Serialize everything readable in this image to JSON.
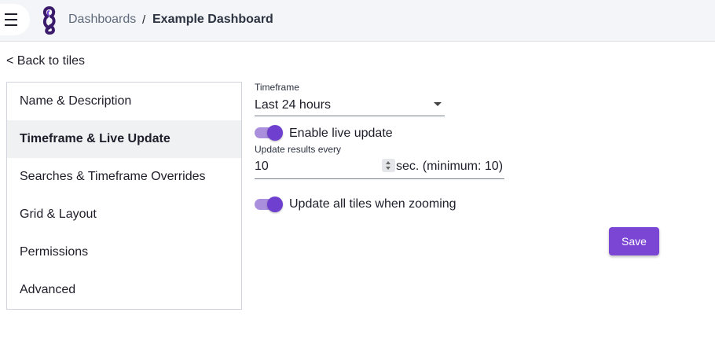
{
  "header": {
    "breadcrumb_parent": "Dashboards",
    "breadcrumb_separator": "/",
    "breadcrumb_current": "Example Dashboard"
  },
  "back_link": "< Back to tiles",
  "sidebar": {
    "items": [
      {
        "label": "Name & Description",
        "active": false
      },
      {
        "label": "Timeframe & Live Update",
        "active": true
      },
      {
        "label": "Searches & Timeframe Overrides",
        "active": false
      },
      {
        "label": "Grid & Layout",
        "active": false
      },
      {
        "label": "Permissions",
        "active": false
      },
      {
        "label": "Advanced",
        "active": false
      }
    ]
  },
  "form": {
    "timeframe_label": "Timeframe",
    "timeframe_value": "Last 24 hours",
    "live_update_label": "Enable live update",
    "live_update_enabled": true,
    "update_every_label": "Update results every",
    "update_every_value": "10",
    "update_every_suffix": "sec. (minimum: 10)",
    "zoom_label": "Update all tiles when zooming",
    "zoom_enabled": true,
    "save_label": "Save"
  },
  "colors": {
    "accent": "#7b46d4",
    "switch_track": "#a98fdc",
    "header_bg": "#f4f5f8"
  }
}
